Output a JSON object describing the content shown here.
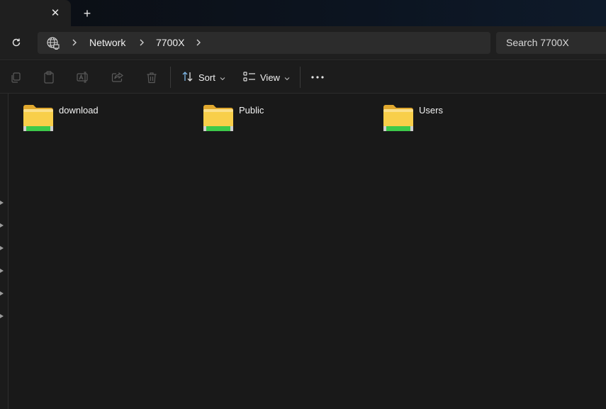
{
  "tabs": {
    "close_glyph": "✕",
    "new_tab_glyph": "+"
  },
  "address": {
    "crumbs": [
      "Network",
      "7700X"
    ],
    "search_placeholder": "Search 7700X"
  },
  "commandbar": {
    "sort_label": "Sort",
    "view_label": "View"
  },
  "folders": [
    {
      "name": "download"
    },
    {
      "name": "Public"
    },
    {
      "name": "Users"
    }
  ],
  "colors": {
    "background": "#191919",
    "folder_yellow": "#f5c842",
    "folder_green": "#3cc94a"
  }
}
